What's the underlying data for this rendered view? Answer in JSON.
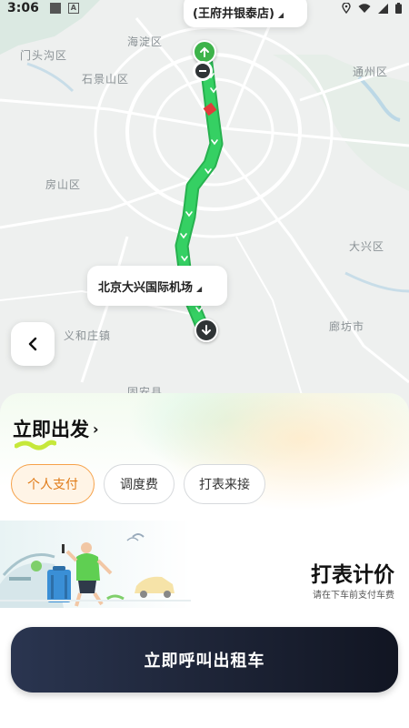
{
  "status_bar": {
    "time": "3:06",
    "icons": [
      "screenshot-icon",
      "a-icon",
      "location-icon",
      "wifi-icon",
      "signal-icon",
      "battery-icon"
    ]
  },
  "map": {
    "districts": [
      "门头沟区",
      "海淀区",
      "石景山区",
      "通州区",
      "房山区",
      "大兴区",
      "义和庄镇",
      "廊坊市",
      "固安县"
    ],
    "start_label": "(王府井银泰店)",
    "end_label": "北京大兴国际机场",
    "route_color": "#2ecc5f",
    "congestion_color": "#e23b3b"
  },
  "panel": {
    "depart_label": "立即出发",
    "payment_options": [
      "个人支付",
      "调度费",
      "打表来接"
    ],
    "selected_option": "个人支付",
    "pricing_title": "打表计价",
    "pricing_subtitle": "请在下车前支付车费",
    "call_button": "立即呼叫出租车",
    "accent_color": "#f6a24a"
  }
}
